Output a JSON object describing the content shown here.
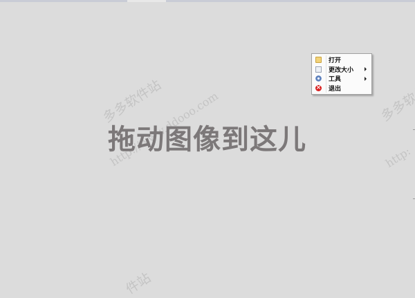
{
  "drop_area": {
    "prompt": "拖动图像到这儿"
  },
  "context_menu": {
    "items": [
      {
        "label": "打开",
        "icon": "folder-open-icon",
        "has_submenu": false
      },
      {
        "label": "更改大小",
        "icon": "resize-icon",
        "has_submenu": true
      },
      {
        "label": "工具",
        "icon": "gear-icon",
        "has_submenu": true
      },
      {
        "label": "退出",
        "icon": "exit-icon",
        "has_submenu": false
      }
    ]
  },
  "watermark": {
    "brand": "多多软件站",
    "url": "http://www.ddooo.com",
    "brand_short": "多多软件",
    "url_short": "http:",
    "brand_partial": "件站"
  }
}
